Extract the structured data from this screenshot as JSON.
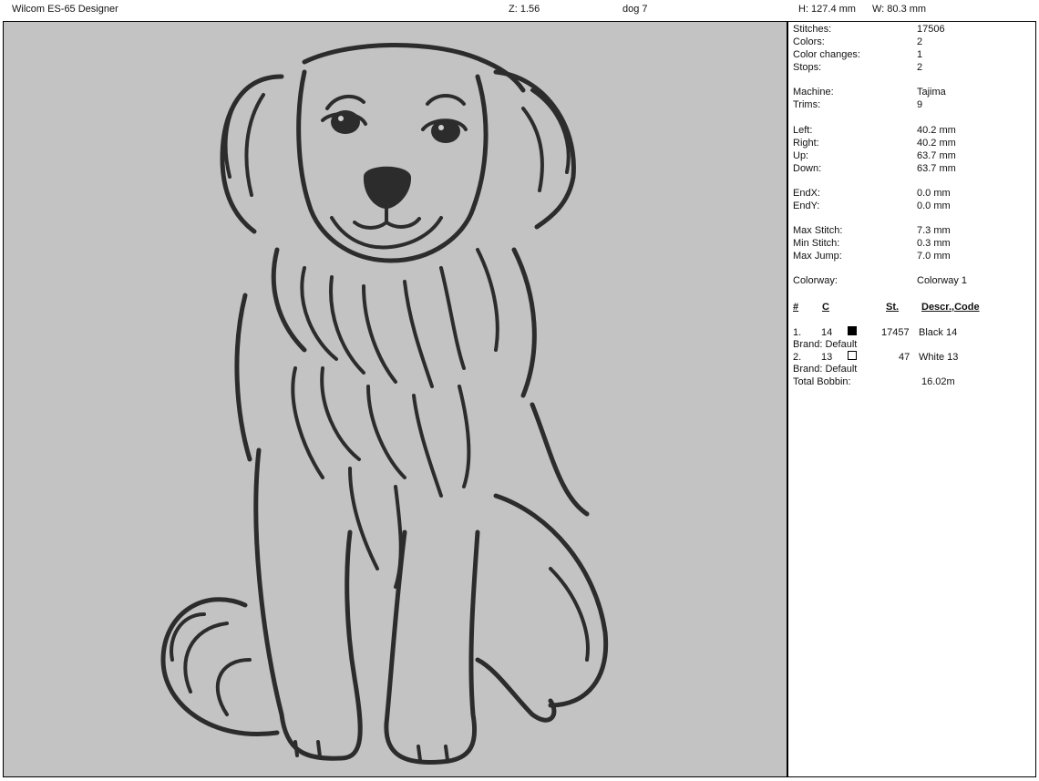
{
  "header": {
    "app_title": "Wilcom ES-65 Designer",
    "zoom": "Z: 1.56",
    "design_name": "dog 7",
    "height": "H: 127.4 mm",
    "width": "W: 80.3 mm"
  },
  "stats": {
    "stitches": {
      "label": "Stitches:",
      "value": "17506"
    },
    "colors": {
      "label": "Colors:",
      "value": "2"
    },
    "color_changes": {
      "label": "Color changes:",
      "value": "1"
    },
    "stops": {
      "label": "Stops:",
      "value": "2"
    },
    "machine": {
      "label": "Machine:",
      "value": "Tajima"
    },
    "trims": {
      "label": "Trims:",
      "value": "9"
    },
    "left": {
      "label": "Left:",
      "value": "40.2 mm"
    },
    "right": {
      "label": "Right:",
      "value": "40.2 mm"
    },
    "up": {
      "label": "Up:",
      "value": "63.7 mm"
    },
    "down": {
      "label": "Down:",
      "value": "63.7 mm"
    },
    "endx": {
      "label": "EndX:",
      "value": "0.0 mm"
    },
    "endy": {
      "label": "EndY:",
      "value": "0.0 mm"
    },
    "max_stitch": {
      "label": "Max Stitch:",
      "value": "7.3 mm"
    },
    "min_stitch": {
      "label": "Min Stitch:",
      "value": "0.3 mm"
    },
    "max_jump": {
      "label": "Max Jump:",
      "value": "7.0 mm"
    },
    "colorway": {
      "label": "Colorway:",
      "value": "Colorway 1"
    }
  },
  "table": {
    "headers": {
      "num": "#",
      "c": "C",
      "st": "St.",
      "descr": "Descr.,Code"
    },
    "rows": [
      {
        "num": "1.",
        "c": "14",
        "st": "17457",
        "descr": "Black 14",
        "brand": "Brand: Default",
        "swatch_color": "#000000"
      },
      {
        "num": "2.",
        "c": "13",
        "st": "47",
        "descr": "White 13",
        "brand": "Brand: Default",
        "swatch_color": "#ffffff"
      }
    ],
    "total_bobbin": {
      "label": "Total Bobbin:",
      "value": "16.02m"
    }
  },
  "colors": {
    "canvas_bg": "#c3c3c3",
    "thread": "#2c2c2c"
  }
}
